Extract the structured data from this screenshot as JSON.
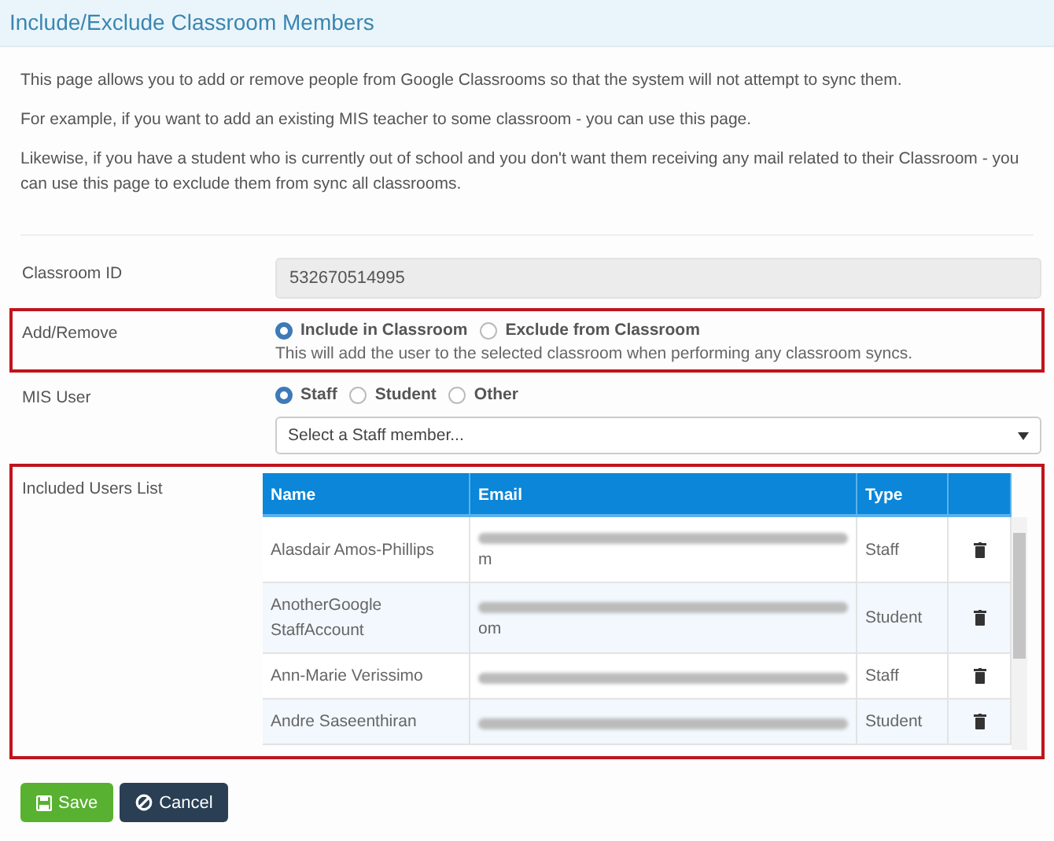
{
  "panel": {
    "title": "Include/Exclude Classroom Members"
  },
  "intro": [
    "This page allows you to add or remove people from Google Classrooms so that the system will not attempt to sync them.",
    "For example, if you want to add an existing MIS teacher to some classroom - you can use this page.",
    "Likewise, if you have a student who is currently out of school and you don't want them receiving any mail related to their Classroom - you can use this page to exclude them from sync all classrooms."
  ],
  "classroom_id": {
    "label": "Classroom ID",
    "value": "532670514995"
  },
  "add_remove": {
    "label": "Add/Remove",
    "highlighted": true,
    "options": [
      {
        "label": "Include in Classroom",
        "selected": true
      },
      {
        "label": "Exclude from Classroom",
        "selected": false
      }
    ],
    "help": "This will add the user to the selected classroom when performing any classroom syncs."
  },
  "mis_user": {
    "label": "MIS User",
    "highlighted": false,
    "options": [
      {
        "label": "Staff",
        "selected": true
      },
      {
        "label": "Student",
        "selected": false
      },
      {
        "label": "Other",
        "selected": false
      }
    ],
    "select": {
      "value": "Select a Staff member..."
    }
  },
  "users_list": {
    "label": "Included Users List",
    "highlighted": true,
    "columns": [
      "Name",
      "Email",
      "Type"
    ],
    "rows": [
      {
        "name": "Alasdair Amos-Phillips",
        "email_tail": "m",
        "type": "Staff"
      },
      {
        "name": "AnotherGoogle StaffAccount",
        "email_tail": "om",
        "type": "Student"
      },
      {
        "name": "Ann-Marie Verissimo",
        "type": "Staff"
      },
      {
        "name": "Andre Saseenthiran",
        "type": "Student"
      }
    ]
  },
  "buttons": [
    {
      "kind": "save",
      "label": "Save"
    },
    {
      "kind": "cancel",
      "label": "Cancel"
    }
  ]
}
